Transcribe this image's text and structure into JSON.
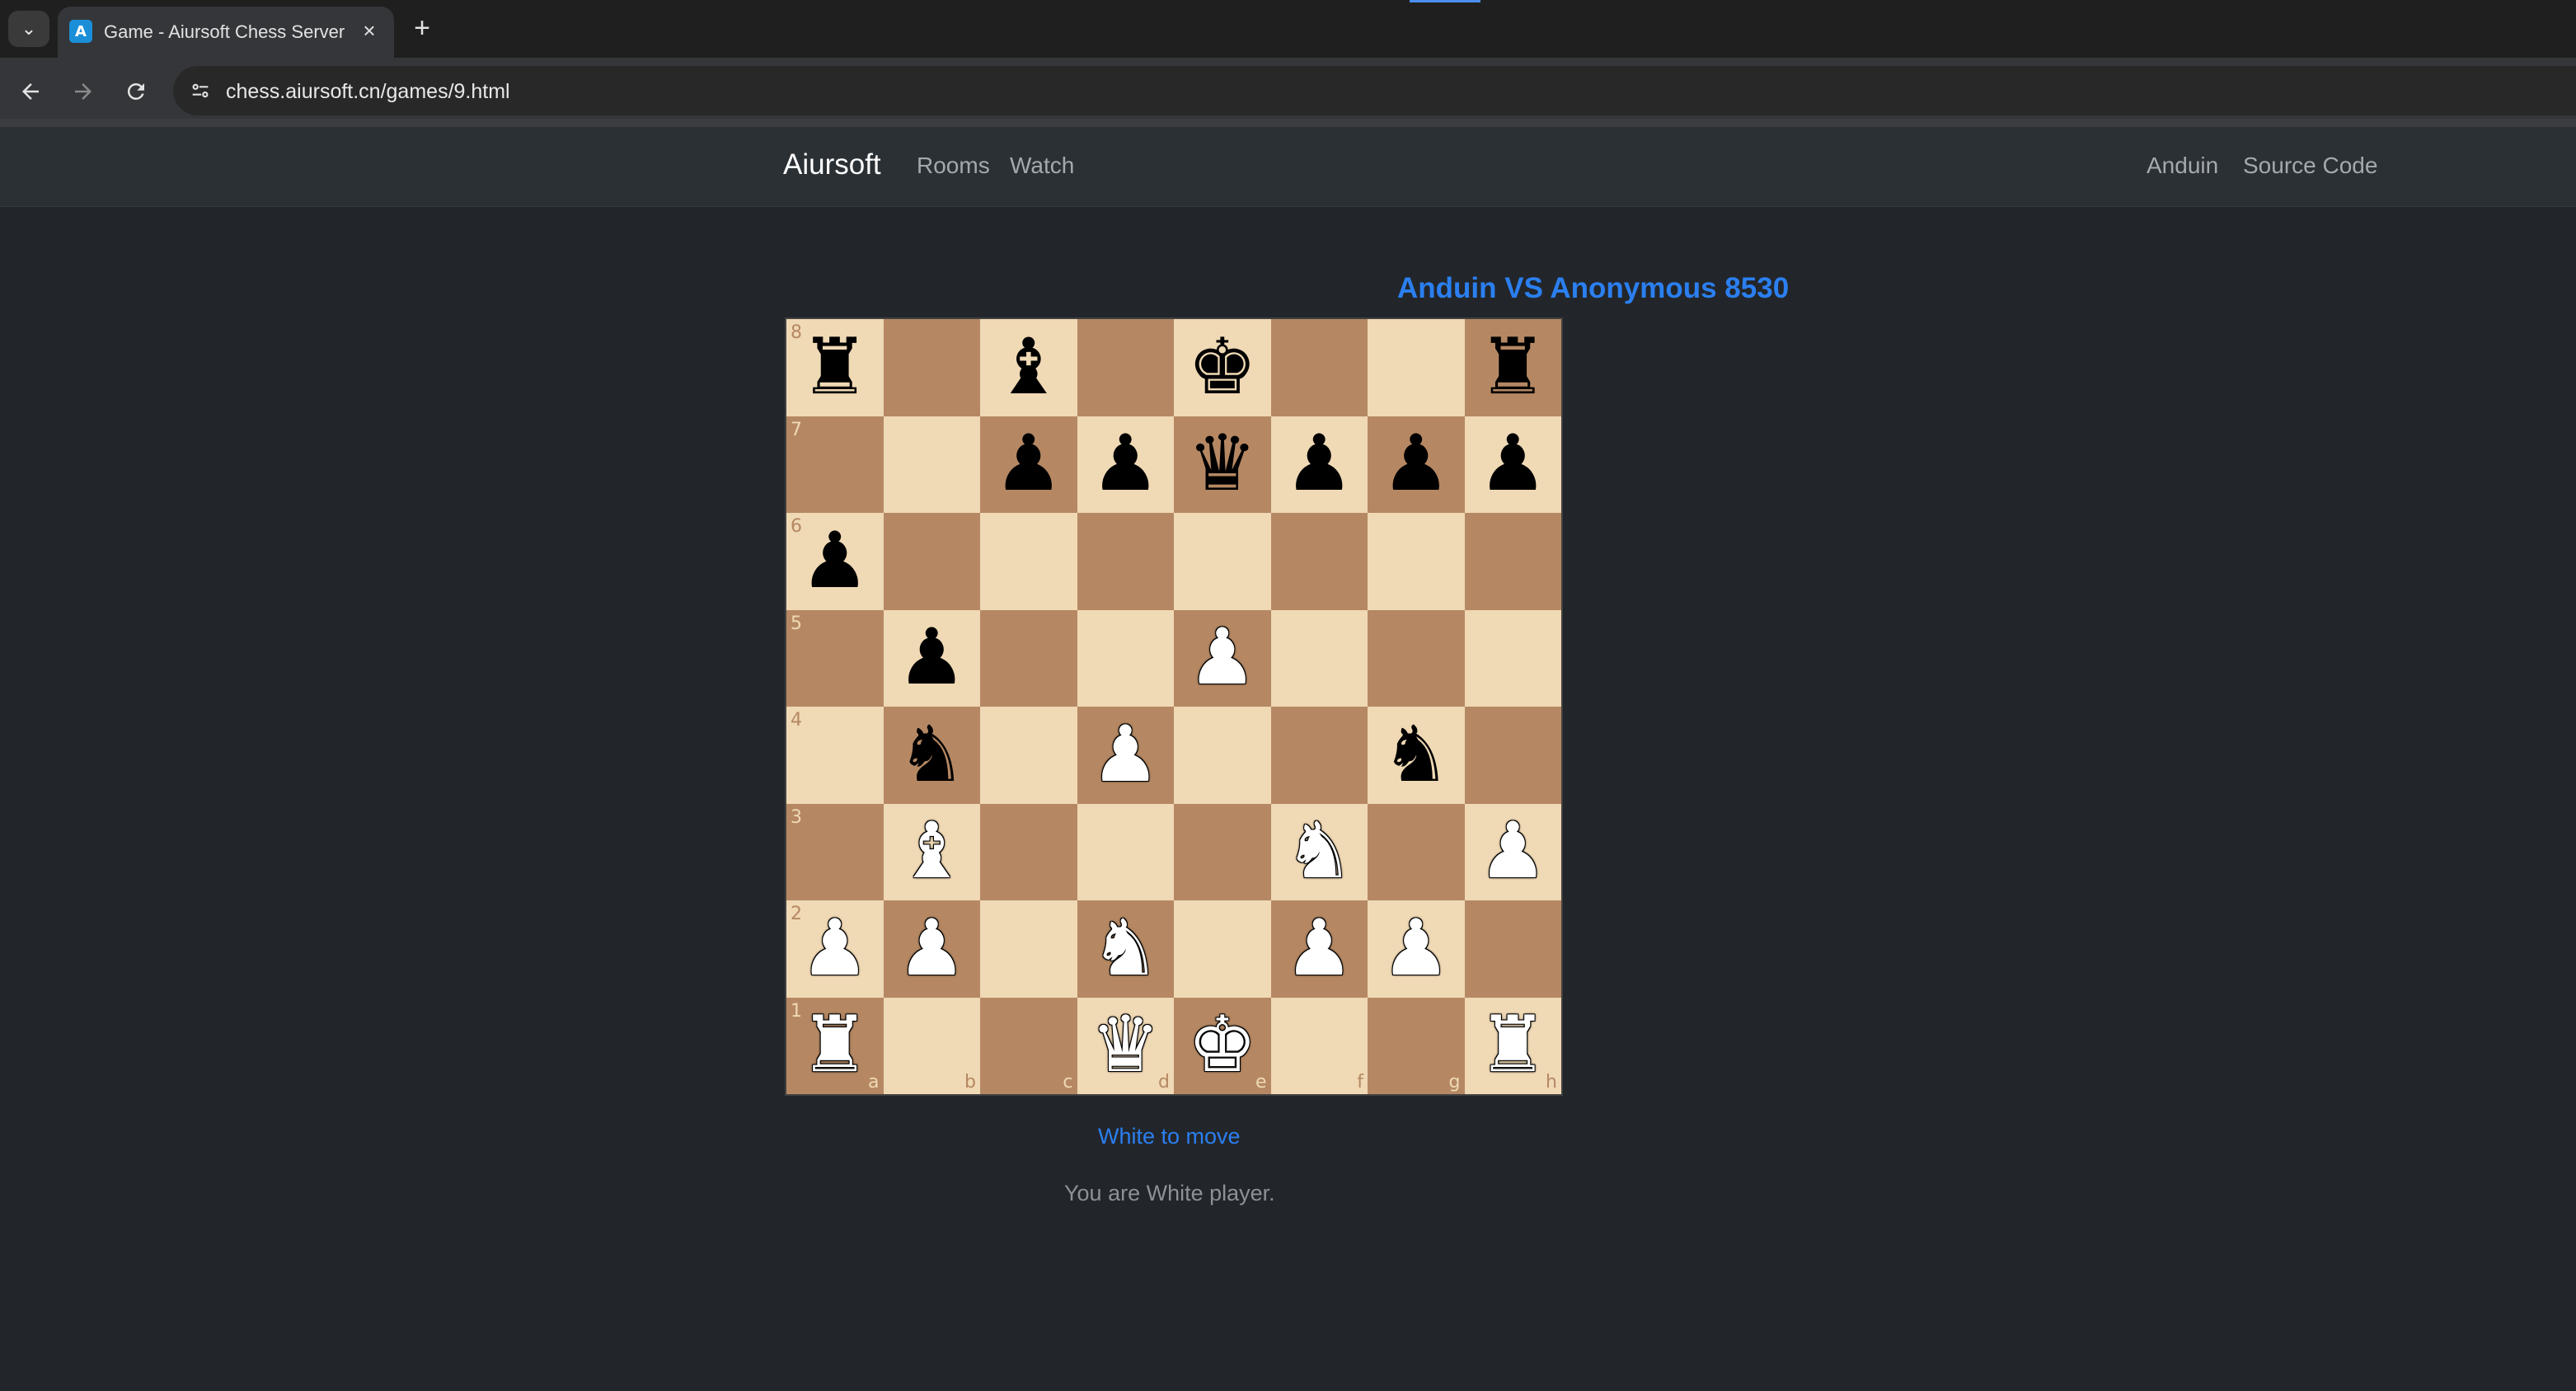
{
  "browser": {
    "tab_title": "Game - Aiursoft Chess Server",
    "new_tab_label": "+",
    "close_label": "×",
    "url": "chess.aiursoft.cn/games/9.html"
  },
  "navbar": {
    "brand": "Aiursoft",
    "links": [
      "Rooms",
      "Watch"
    ],
    "right_links": [
      "Anduin",
      "Source Code"
    ]
  },
  "game": {
    "title": "Anduin VS Anonymous 8530",
    "status": "White to move",
    "player_note": "You are White player.",
    "board_colors": {
      "light": "#f0d9b5",
      "dark": "#b58863"
    },
    "files": [
      "a",
      "b",
      "c",
      "d",
      "e",
      "f",
      "g",
      "h"
    ],
    "ranks": [
      "8",
      "7",
      "6",
      "5",
      "4",
      "3",
      "2",
      "1"
    ],
    "position": [
      [
        "br",
        "",
        "bb",
        "",
        "bk",
        "",
        "",
        "br"
      ],
      [
        "",
        "",
        "bp",
        "bp",
        "bq",
        "bp",
        "bp",
        "bp"
      ],
      [
        "bp",
        "",
        "",
        "",
        "",
        "",
        "",
        ""
      ],
      [
        "",
        "bp",
        "",
        "",
        "wp",
        "",
        "",
        ""
      ],
      [
        "",
        "bn",
        "",
        "wp",
        "",
        "",
        "bn",
        ""
      ],
      [
        "",
        "wb",
        "",
        "",
        "",
        "wn",
        "",
        "wp"
      ],
      [
        "wp",
        "wp",
        "",
        "wn",
        "",
        "wp",
        "wp",
        ""
      ],
      [
        "wr",
        "",
        "",
        "wq",
        "wk",
        "",
        "",
        "wr"
      ]
    ]
  }
}
